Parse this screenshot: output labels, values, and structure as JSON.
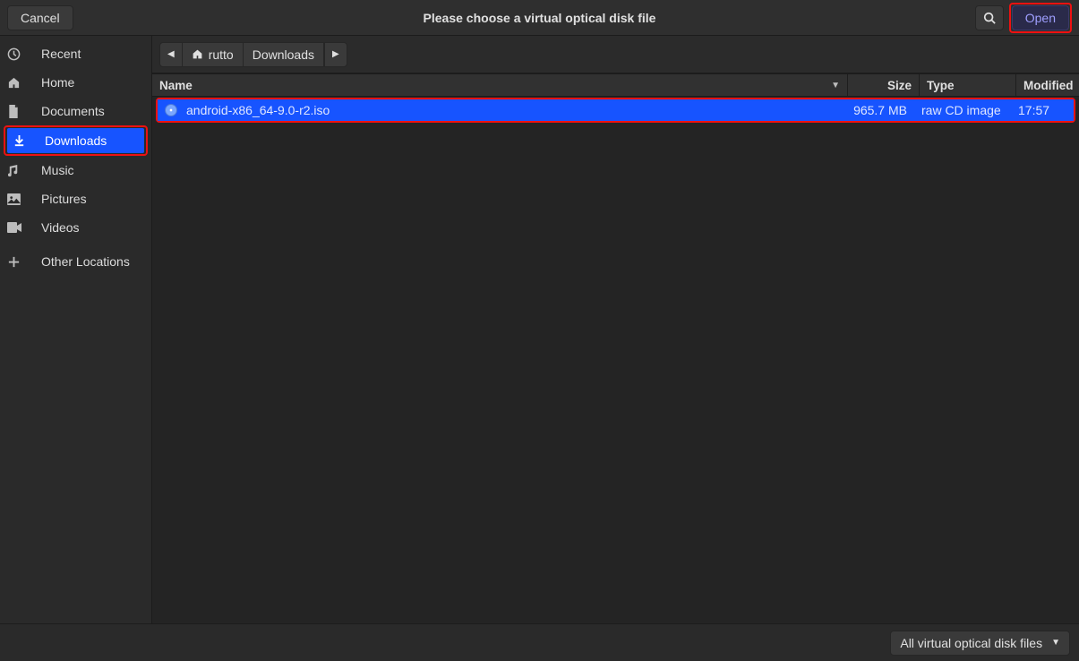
{
  "header": {
    "cancel": "Cancel",
    "title": "Please choose a virtual optical disk file",
    "open": "Open"
  },
  "sidebar": {
    "items": [
      {
        "icon": "clock",
        "label": "Recent"
      },
      {
        "icon": "home",
        "label": "Home"
      },
      {
        "icon": "doc",
        "label": "Documents"
      },
      {
        "icon": "download",
        "label": "Downloads",
        "active": true
      },
      {
        "icon": "music",
        "label": "Music"
      },
      {
        "icon": "picture",
        "label": "Pictures"
      },
      {
        "icon": "video",
        "label": "Videos"
      },
      {
        "icon": "plus",
        "label": "Other Locations"
      }
    ]
  },
  "pathbar": {
    "home_label": "rutto",
    "current": "Downloads"
  },
  "columns": {
    "name": "Name",
    "size": "Size",
    "type": "Type",
    "modified": "Modified"
  },
  "files": [
    {
      "name": "android-x86_64-9.0-r2.iso",
      "size": "965.7 MB",
      "type": "raw CD image",
      "modified": "17:57"
    }
  ],
  "filter": {
    "selected": "All virtual optical disk files"
  }
}
